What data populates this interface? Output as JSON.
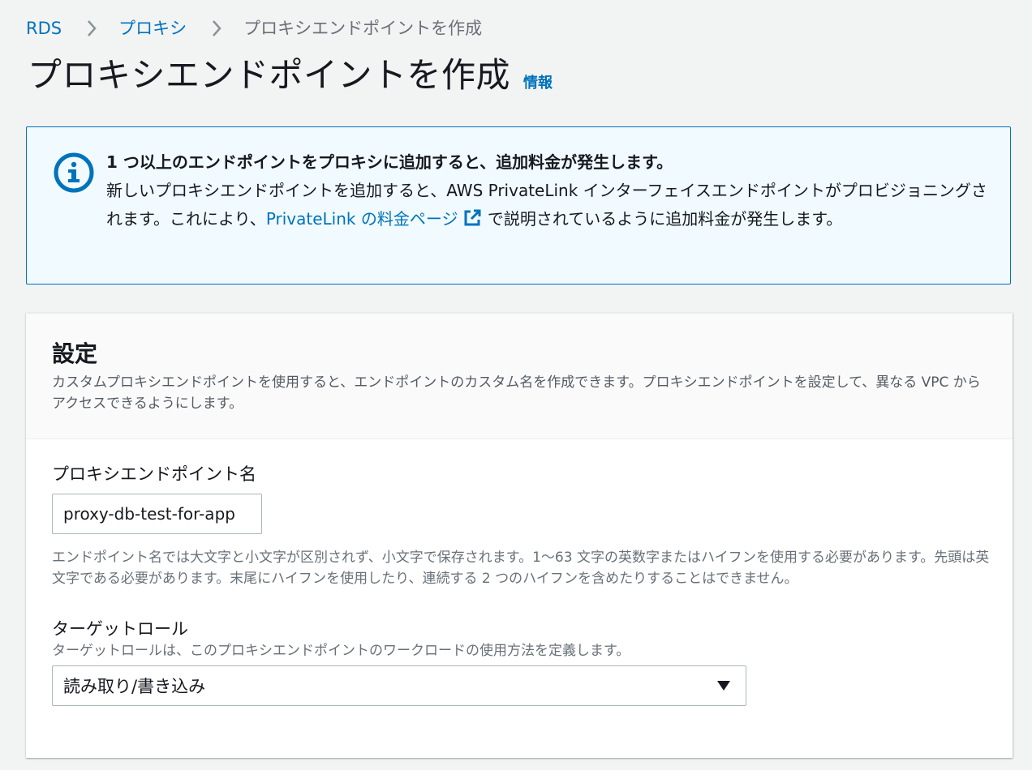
{
  "breadcrumb": {
    "items": [
      "RDS",
      "プロキシ"
    ],
    "current": "プロキシエンドポイントを作成"
  },
  "header": {
    "title": "プロキシエンドポイントを作成",
    "info": "情報"
  },
  "alert": {
    "heading": "1 つ以上のエンドポイントをプロキシに追加すると、追加料金が発生します。",
    "text_before_link": "新しいプロキシエンドポイントを追加すると、AWS PrivateLink インターフェイスエンドポイントがプロビジョニングされます。これにより、",
    "link": "PrivateLink の料金ページ",
    "text_after_link": " で説明されているように追加料金が発生します。",
    "icon": "info-icon",
    "color": "#0073bb"
  },
  "settings": {
    "title": "設定",
    "description": "カスタムプロキシエンドポイントを使用すると、エンドポイントのカスタム名を作成できます。プロキシエンドポイントを設定して、異なる VPC からアクセスできるようにします。",
    "endpoint_name": {
      "label": "プロキシエンドポイント名",
      "value": "proxy-db-test-for-app",
      "constraint": "エンドポイント名では大文字と小文字が区別されず、小文字で保存されます。1〜63 文字の英数字またはハイフンを使用する必要があります。先頭は英文字である必要があります。末尾にハイフンを使用したり、連続する 2 つのハイフンを含めたりすることはできません。"
    },
    "target_role": {
      "label": "ターゲットロール",
      "description": "ターゲットロールは、このプロキシエンドポイントのワークロードの使用方法を定義します。",
      "selected": "読み取り/書き込み"
    }
  }
}
